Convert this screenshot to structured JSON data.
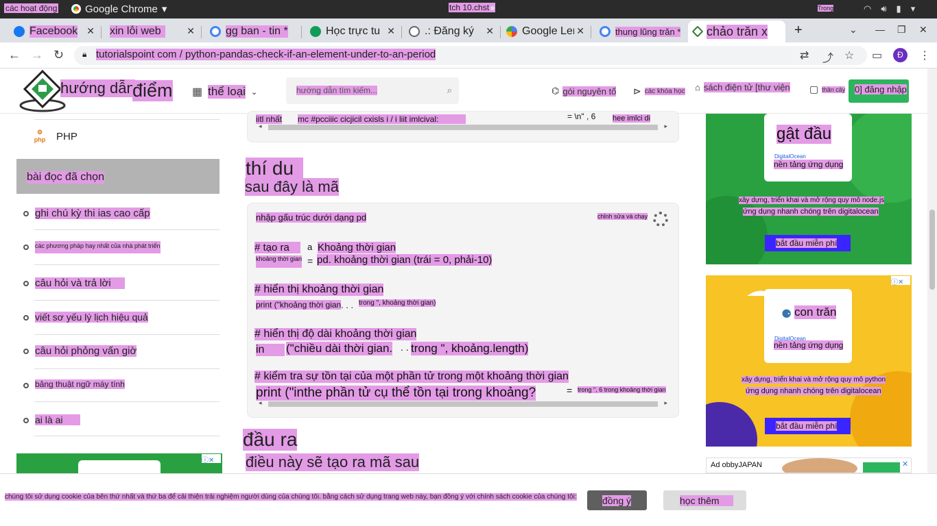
{
  "os": {
    "activities": "các hoạt động",
    "app_name": "Google Chrome",
    "clock": "tch 10.chst",
    "lang": "Trong"
  },
  "tabs": [
    {
      "title": "Facebook",
      "color": "#1877f2"
    },
    {
      "title": "xin lỗi web",
      "color": "#1877f2"
    },
    {
      "title": "gg ban - tin *",
      "color": "#4285f4"
    },
    {
      "title": "Học trực tu",
      "color": "#0f9d58"
    },
    {
      "title": ".: Đăng ký n",
      "color": "#666666"
    },
    {
      "title": "Google Len",
      "color": "#4285f4"
    },
    {
      "title": "thung lũng trăn *",
      "color": "#4285f4"
    },
    {
      "title": "chảo trăn x",
      "color": "#2e7d32"
    }
  ],
  "address": {
    "url": "tutorialspoint com / python-pandas-check-if-an-element-under-to-an-period",
    "avatar": "Đ"
  },
  "header": {
    "brand_1": "hướng dẫn",
    "brand_2": "điểm",
    "category": "thể loại",
    "search_placeholder": "hướng dẫn tìm kiếm...",
    "primes": "gói nguyên tố",
    "courses": "các khóa học",
    "ebooks": "sách điện tử [thư viện",
    "chat": "thân cây",
    "login": "0] đăng nhập"
  },
  "sidebar": {
    "php": "PHP",
    "featured": "bài đọc đã chọn",
    "items": [
      "ghi chú kỳ thi ias cao cấp",
      "các phương pháp hay nhất của nhà phát triển",
      "câu hỏi và trả lời",
      "viết sơ yếu lý lịch hiệu quả",
      "câu hỏi phỏng vấn giờ",
      "bảng thuật ngữ máy tính",
      "ai là ai"
    ]
  },
  "main": {
    "top_code": {
      "left": "iitl nhất",
      "middle": "mc #pcciiic cicjicil cxisls i / i liit imlcival:",
      "right_sym": "=  \\n\" , 6",
      "right": "hee imlci di"
    },
    "example_heading": "thí du",
    "example_sub": "sau đây là mã",
    "edit_run": "chỉnh sửa và chạy",
    "code": {
      "import": "nhập gấu trúc dưới dạng pd",
      "c1": "# tạo ra",
      "c1_a": "a",
      "c1_b": "Khoảng thời gian",
      "l2_var": "khoảng thời gian",
      "l2_eq": "=",
      "l2_rest": "pd. khoảng thời gian (trái = 0, phải-10)",
      "c2": "# hiển thị khoảng thời gian",
      "p1": "print (\"khoảng thời gian",
      "p1_dots": ". . .",
      "p1_rest": "trong \", khoảng thời gian)",
      "c3": "# hiển thị độ dài khoảng thời gian",
      "p2_a": "in",
      "p2_b": "(\"chiều dài thời gian.",
      "p2_dots": ". .",
      "p2_c": "trong \", khoảng.length)",
      "c4": "# kiểm tra sự tồn tại của một phần tử trong một khoảng thời gian",
      "p3": "print (\"inthe phần tử cụ thể tồn tại trong khoảng?",
      "p3_eq": "=",
      "p3_rest": "trong \", 6 trong khoảng thời gian"
    },
    "output_heading": "đầu ra",
    "output_sub": "điều này sẽ tạo ra mã sau"
  },
  "ads": [
    {
      "title": "gật đầu",
      "brand": "DigitalOcean",
      "platform": "nền tảng ứng dụng",
      "line1": "xây dựng, triển khai và mở rộng quy mô node.js",
      "line2": "ứng dụng nhanh chóng trên digitalocean",
      "button": "bắt đầu miễn phí",
      "bg": "#2aa141"
    },
    {
      "title": "con trăn",
      "brand": "DigitalOcean",
      "platform": "nền tảng ứng dụng",
      "line1": "xây dựng, triển khai và mở rộng quy mô python",
      "line2": "ứng dụng nhanh chóng trên digitalocean",
      "button": "bắt đầu miễn phí",
      "bg": "#f7c325"
    }
  ],
  "third_ad": "Ad obbyJAPAN",
  "cookie": {
    "message": "chúng tôi sử dụng cookie của bên thứ nhất và thứ ba để cải thiện trải nghiệm người dùng của chúng tôi. bằng cách sử dụng trang web này, bạn đồng ý với chính sách cookie của chúng tôi:",
    "agree": "đồng ý",
    "learn_more": "học thêm"
  },
  "colors": {
    "highlight": "#e39be6",
    "login_green": "#2db55d",
    "ad_blue_button": "#3a24ff"
  }
}
